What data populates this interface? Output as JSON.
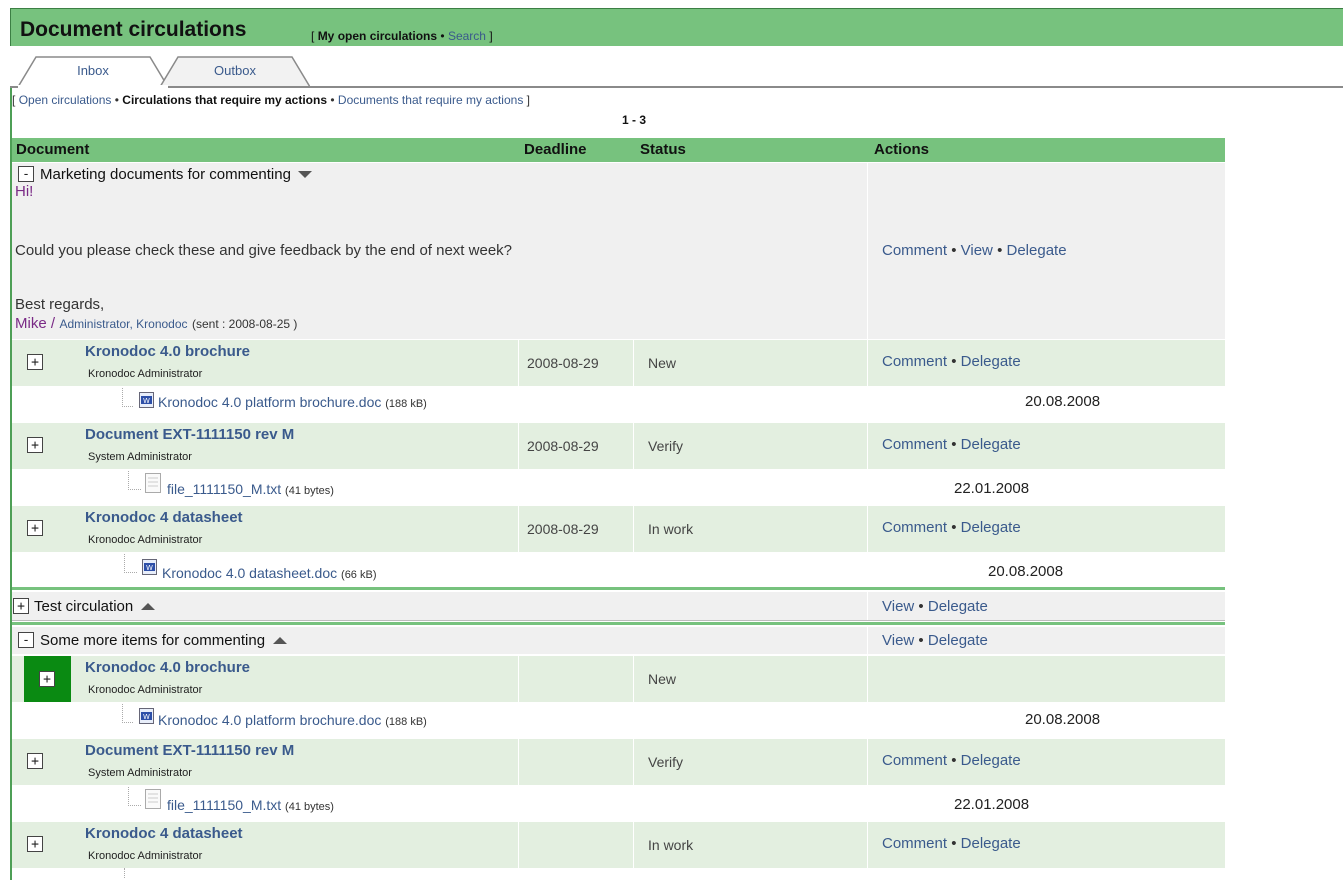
{
  "header": {
    "title": "Document circulations",
    "bracket_open": "[",
    "my_open": "My open circulations",
    "sep": "•",
    "search": "Search",
    "bracket_close": "]"
  },
  "tabs": [
    {
      "label": "Inbox",
      "active": true
    },
    {
      "label": "Outbox",
      "active": false
    }
  ],
  "filters": {
    "bracket_open": "[",
    "open": "Open circulations",
    "sep": "•",
    "require_actions": "Circulations that require my actions",
    "docs_require": "Documents that require my actions",
    "bracket_close": "]"
  },
  "pager": "1 - 3",
  "columns": {
    "document": "Document",
    "deadline": "Deadline",
    "status": "Status",
    "actions": "Actions"
  },
  "actions": {
    "comment": "Comment",
    "view": "View",
    "delegate": "Delegate",
    "sep": "•"
  },
  "toggles": {
    "collapse": "-",
    "expand": "+"
  },
  "groups": [
    {
      "title": "Marketing documents for commenting",
      "message": {
        "line1": "Hi!",
        "line2": "Could you please check these and give feedback by the end of next week?",
        "line3": "Best regards,",
        "sender": "Mike /",
        "sender_role": "Administrator, Kronodoc",
        "sent": "(sent : 2008-08-25 )"
      },
      "items": [
        {
          "title": "Kronodoc 4.0 brochure",
          "owner": "Kronodoc Administrator",
          "deadline": "2008-08-29",
          "status": "New",
          "file": "Kronodoc 4.0 platform brochure.doc",
          "size": "(188 kB)",
          "date": "20.08.2008"
        },
        {
          "title": "Document EXT-1111150 rev M",
          "owner": "System Administrator",
          "deadline": "2008-08-29",
          "status": "Verify",
          "file": "file_1111150_M.txt",
          "size": "(41 bytes)",
          "date": "22.01.2008"
        },
        {
          "title": "Kronodoc 4 datasheet",
          "owner": "Kronodoc Administrator",
          "deadline": "2008-08-29",
          "status": "In work",
          "file": "Kronodoc 4.0 datasheet.doc",
          "size": "(66 kB)",
          "date": "20.08.2008"
        }
      ]
    },
    {
      "title": "Test circulation"
    },
    {
      "title": "Some more items for commenting",
      "items": [
        {
          "title": "Kronodoc 4.0 brochure",
          "owner": "Kronodoc Administrator",
          "status": "New",
          "file": "Kronodoc 4.0 platform brochure.doc",
          "size": "(188 kB)",
          "date": "20.08.2008"
        },
        {
          "title": "Document EXT-1111150 rev M",
          "owner": "System Administrator",
          "status": "Verify",
          "file": "file_1111150_M.txt",
          "size": "(41 bytes)",
          "date": "22.01.2008"
        },
        {
          "title": "Kronodoc 4 datasheet",
          "owner": "Kronodoc Administrator",
          "status": "In work"
        }
      ]
    }
  ],
  "colors": {
    "header_green": "#77c27e",
    "row_green": "#e3efe0",
    "row_gray": "#f0f0f0",
    "link": "#3a5a8c",
    "active_toggle": "#0a8a12"
  }
}
